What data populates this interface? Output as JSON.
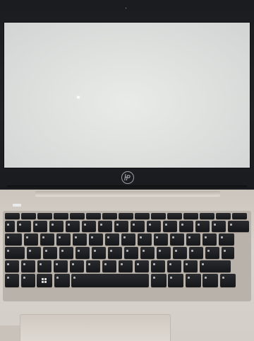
{
  "photo": {
    "subject": "hp-laptop",
    "colors": {
      "bezel": "#1d1e21",
      "screen": "#dfe1df",
      "chassis": "#d6d2cc",
      "keys": "#1a1b1e",
      "key_glyph": "#d9d9d9"
    },
    "icons": [
      "hp-logo-icon",
      "webcam-icon",
      "windows-key-icon"
    ]
  }
}
